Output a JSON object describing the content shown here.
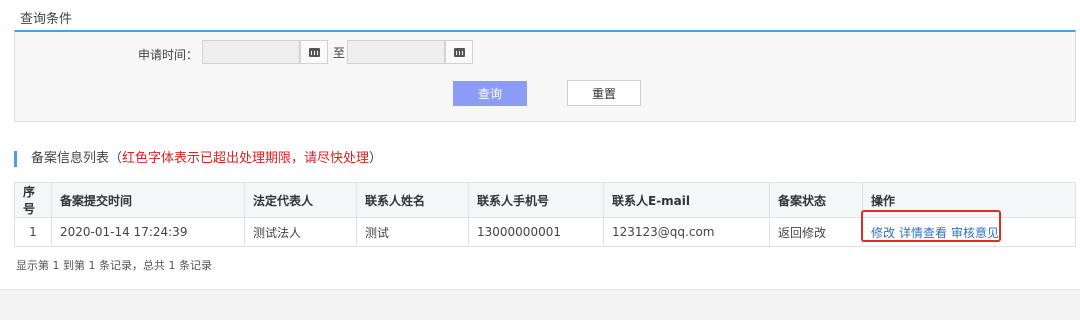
{
  "query": {
    "section_title": "查询条件",
    "date_label": "申请时间：",
    "range_separator": "至",
    "start_date": "",
    "end_date": "",
    "search_label": "查询",
    "reset_label": "重置"
  },
  "list": {
    "title": "备案信息列表（",
    "warning": "红色字体表示已超出处理期限，请尽快处理",
    "title_end": "）",
    "columns": [
      "序号",
      "备案提交时间",
      "法定代表人",
      "联系人姓名",
      "联系人手机号",
      "联系人E-mail",
      "备案状态",
      "操作"
    ],
    "rows": [
      {
        "index": "1",
        "submit_time": "2020-01-14 17:24:39",
        "legal_rep": "测试法人",
        "contact_name": "测试",
        "phone": "13000000001",
        "email": "123123@qq.com",
        "status": "返回修改",
        "actions": [
          "修改",
          "详情查看",
          "审核意见"
        ]
      }
    ],
    "footer": "显示第 1 到第 1 条记录，总共 1 条记录"
  },
  "colors": {
    "accent": "#4a9fe0",
    "search_button": "#8c9cf5",
    "warning_text": "#e02020",
    "link": "#2f6fc6",
    "highlight_box": "#d93025"
  }
}
